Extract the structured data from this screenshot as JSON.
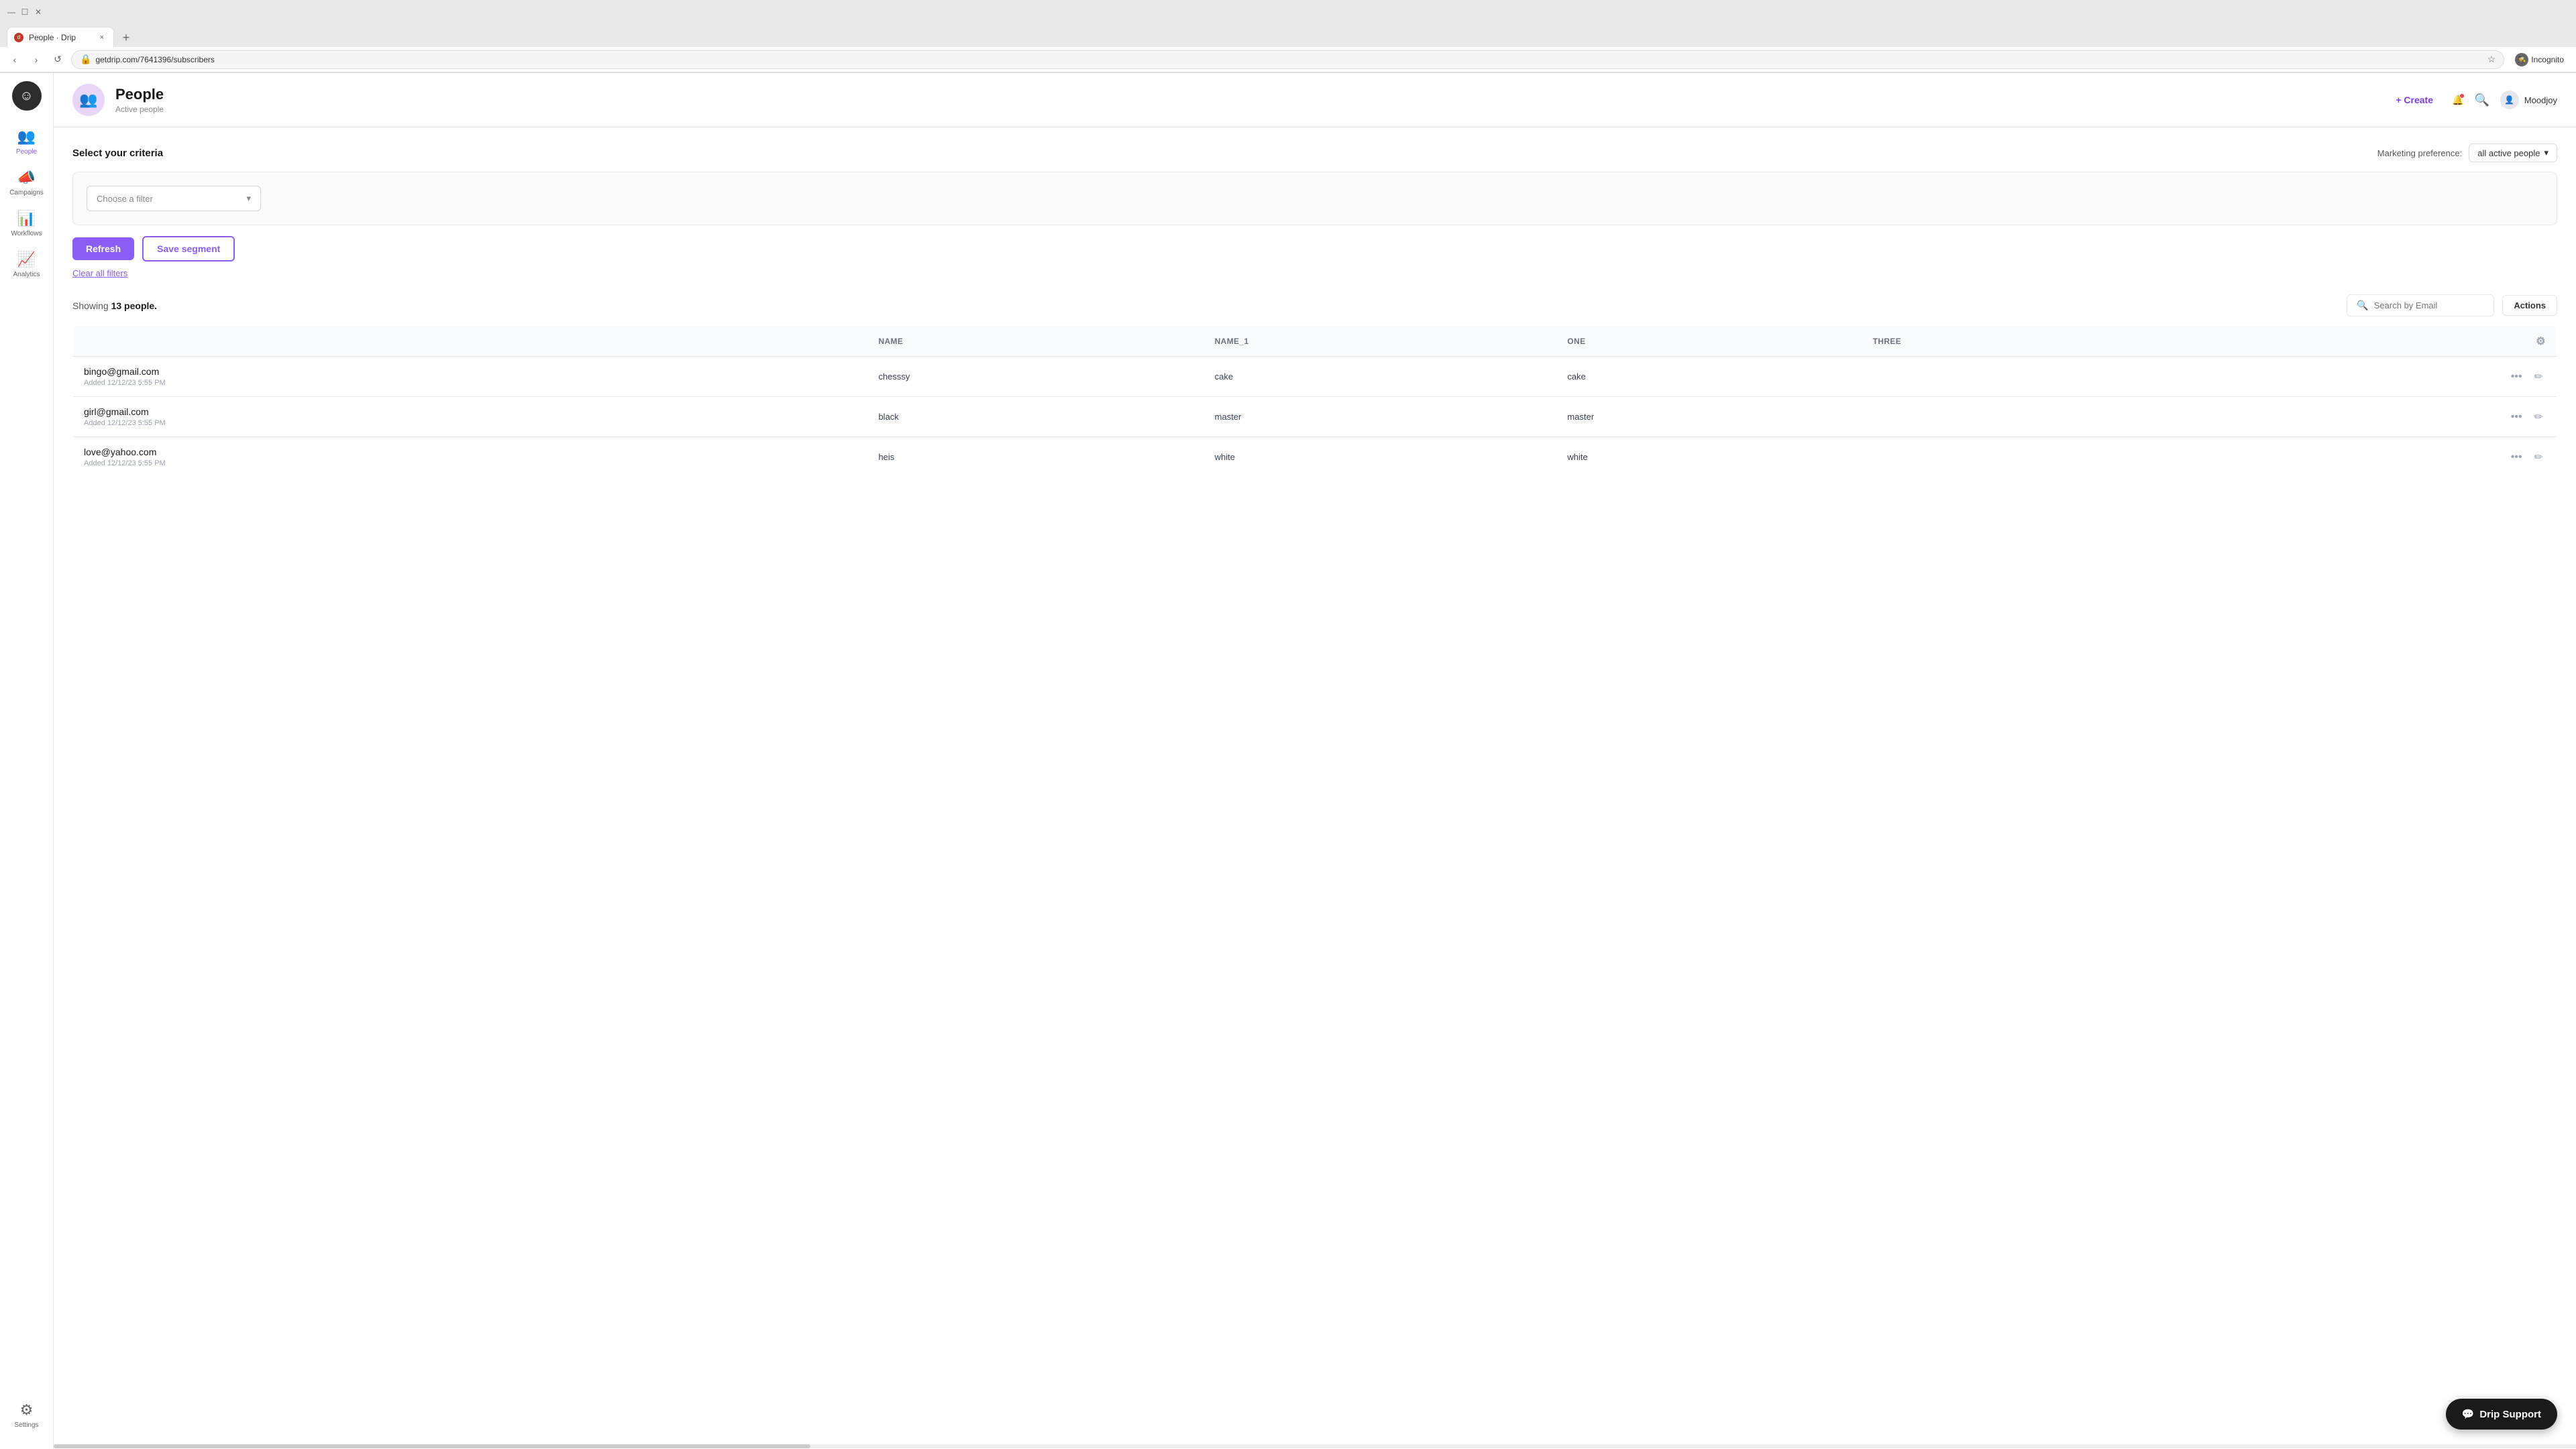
{
  "browser": {
    "tab_title": "People · Drip",
    "tab_close": "×",
    "tab_new": "+",
    "address": "getdrip.com/7641396/subscribers",
    "incognito_label": "Incognito",
    "nav_back": "‹",
    "nav_forward": "›",
    "nav_refresh": "↺",
    "lock_icon": "🔒",
    "star_icon": "☆"
  },
  "sidebar": {
    "logo": "☺",
    "items": [
      {
        "id": "people",
        "label": "People",
        "icon": "👥",
        "active": true
      },
      {
        "id": "campaigns",
        "label": "Campaigns",
        "icon": "📣",
        "active": false
      },
      {
        "id": "workflows",
        "label": "Workflows",
        "icon": "📊",
        "active": false
      },
      {
        "id": "analytics",
        "label": "Analytics",
        "icon": "📈",
        "active": false
      }
    ],
    "settings": {
      "label": "Settings",
      "icon": "⚙"
    }
  },
  "header": {
    "avatar_emoji": "👥",
    "title": "People",
    "subtitle": "Active people",
    "create_label": "+ Create",
    "notification_icon": "🔔",
    "search_icon": "🔍",
    "user_icon": "👤",
    "username": "Moodjoy",
    "more_icon": "⋮"
  },
  "filter": {
    "section_title": "Select your criteria",
    "placeholder": "Choose a filter",
    "dropdown_arrow": "▾",
    "marketing_pref_label": "Marketing preference:",
    "marketing_pref_value": "all active people",
    "marketing_pref_arrow": "▾",
    "refresh_label": "Refresh",
    "save_segment_label": "Save segment",
    "clear_filters_label": "Clear all filters"
  },
  "table": {
    "showing_prefix": "Showing ",
    "count": "13 people.",
    "search_placeholder": "Search by Email",
    "actions_label": "Actions",
    "columns": [
      {
        "key": "email",
        "label": ""
      },
      {
        "key": "name",
        "label": "Name"
      },
      {
        "key": "name1",
        "label": "Name_1"
      },
      {
        "key": "one",
        "label": "one"
      },
      {
        "key": "three",
        "label": "three"
      },
      {
        "key": "settings",
        "label": "⚙"
      }
    ],
    "rows": [
      {
        "email": "bingo@gmail.com",
        "added": "Added 12/12/23 5:55 PM",
        "name": "chesssy",
        "name1": "cake",
        "one": "cake",
        "three": ""
      },
      {
        "email": "girl@gmail.com",
        "added": "Added 12/12/23 5:55 PM",
        "name": "black",
        "name1": "master",
        "one": "master",
        "three": ""
      },
      {
        "email": "love@yahoo.com",
        "added": "Added 12/12/23 5:55 PM",
        "name": "heis",
        "name1": "white",
        "one": "white",
        "three": ""
      }
    ],
    "more_icon": "•••",
    "edit_icon": "✏"
  },
  "drip_support": {
    "label": "Drip Support",
    "icon": "💬"
  }
}
